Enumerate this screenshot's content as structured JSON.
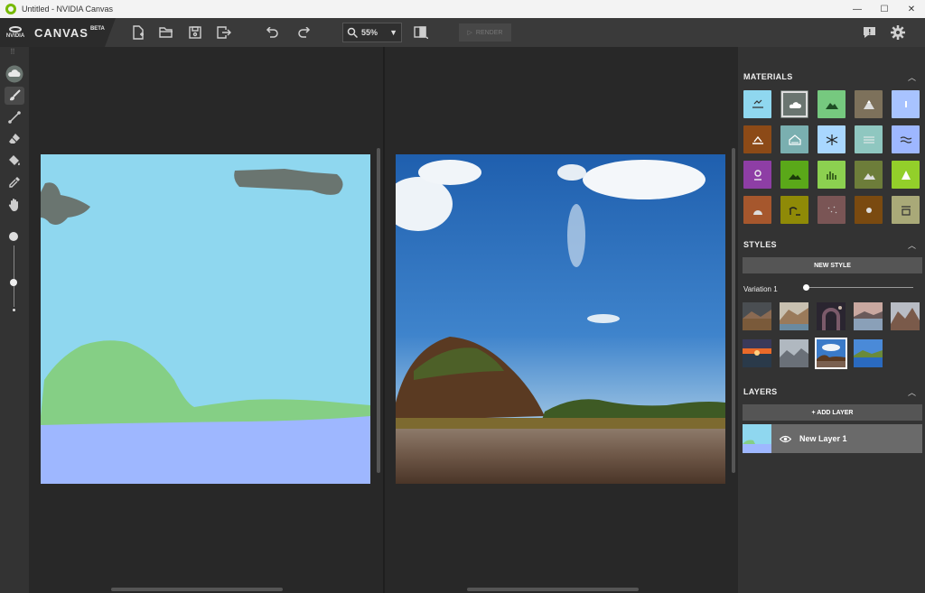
{
  "window": {
    "title": "Untitled - NVIDIA Canvas",
    "minimize": "—",
    "maximize": "☐",
    "close": "✕"
  },
  "brand": {
    "logo_text": "NVIDIA",
    "name": "CANVAS",
    "badge": "BETA"
  },
  "toolbar": {
    "icons": [
      "new-file-icon",
      "open-folder-icon",
      "save-icon",
      "export-icon",
      "undo-icon",
      "redo-icon",
      "compare-icon",
      "feedback-icon",
      "settings-icon"
    ],
    "zoom_value": "55%",
    "render_label": "RENDER"
  },
  "materials": {
    "title": "MATERIALS",
    "colors": [
      "#8fd7ef",
      "#6a7570",
      "#76c97f",
      "#7d715b",
      "#a8c3ff",
      "#8c4a17",
      "#7aafb0",
      "#a9d7ff",
      "#8fc7c0",
      "#9eb7ff",
      "#8e3ea5",
      "#5aa819",
      "#8cd050",
      "#6d7d3a",
      "#93cf2a",
      "#a6572d",
      "#8f8a07",
      "#7a5555",
      "#7a4a10",
      "#a9a978"
    ]
  },
  "styles": {
    "title": "STYLES",
    "new_style_label": "NEW STYLE",
    "variation_label": "Variation 1",
    "variation_level": 0.0
  },
  "layers": {
    "title": "LAYERS",
    "add_layer_label": "+ ADD LAYER",
    "items": [
      {
        "name": "New Layer 1"
      }
    ]
  }
}
